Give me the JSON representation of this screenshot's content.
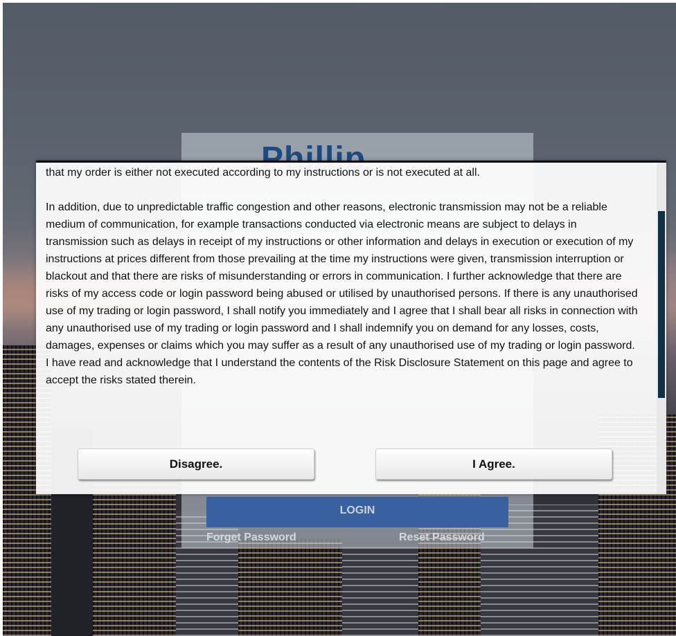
{
  "background": {
    "brand_logo_partial": "Phillip",
    "login_button": "LOGIN",
    "forget_password": "Forget Password",
    "reset_password": "Reset Password"
  },
  "modal": {
    "paragraphs": [
      "that my order is either not executed according to my instructions or is not executed at all.",
      "In addition, due to unpredictable traffic congestion and other reasons, electronic transmission may not be a reliable medium of communication, for example transactions conducted via electronic means are subject to delays in transmission such as delays in receipt of my instructions or other information and delays in execution or execution of my instructions at prices different from those prevailing at the time my instructions were given, transmission interruption or blackout and that there are risks of misunderstanding or errors in communication. I further acknowledge that there are risks of my access code or login password being abused or utilised by unauthorised persons. If there is any unauthorised use of my trading or login password, I shall notify you immediately and I agree that I shall bear all risks in connection with any unauthorised use of my trading or login password and I shall indemnify you on demand for any losses, costs, damages, expenses or claims which you may suffer as a result of any unauthorised use of my trading or login password. I have read and acknowledge that I understand the contents of the Risk Disclosure Statement on this page and agree to accept the risks stated therein."
    ],
    "disagree_label": "Disagree.",
    "agree_label": "I Agree."
  },
  "colors": {
    "scroll_thumb": "#0e2f44",
    "login_button": "#3d67a8",
    "logo": "#1f4f86"
  }
}
